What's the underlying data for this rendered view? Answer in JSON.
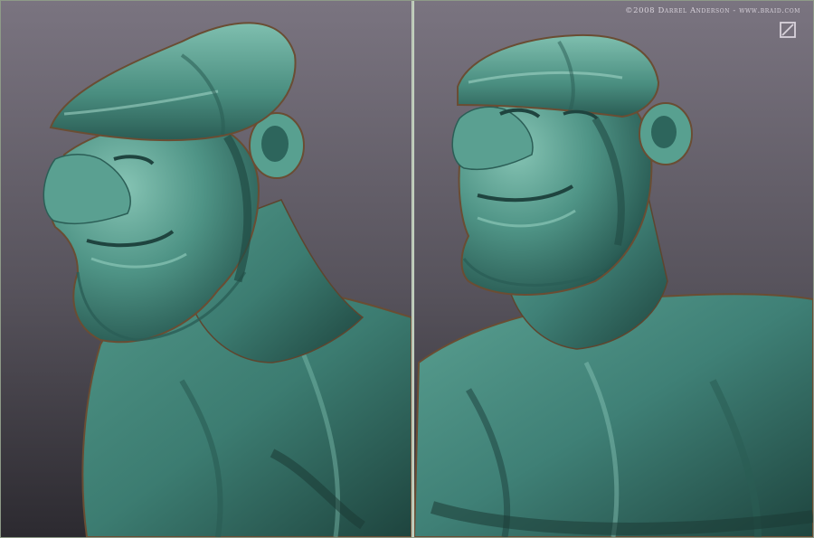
{
  "image": {
    "credit": "©2008 Darrel Anderson - www.braid.com",
    "logo_icon": "braid-square-slash-logo",
    "subject": "two-views-of-sculpted-bust",
    "colors": {
      "background_top": "#75707b",
      "background_bottom": "#2f2d33",
      "clay_light": "#6bb0a1",
      "clay_mid": "#3f8076",
      "clay_shadow": "#214b45",
      "clay_rim": "#7a5a3a",
      "frame": "#8e9a88"
    }
  }
}
